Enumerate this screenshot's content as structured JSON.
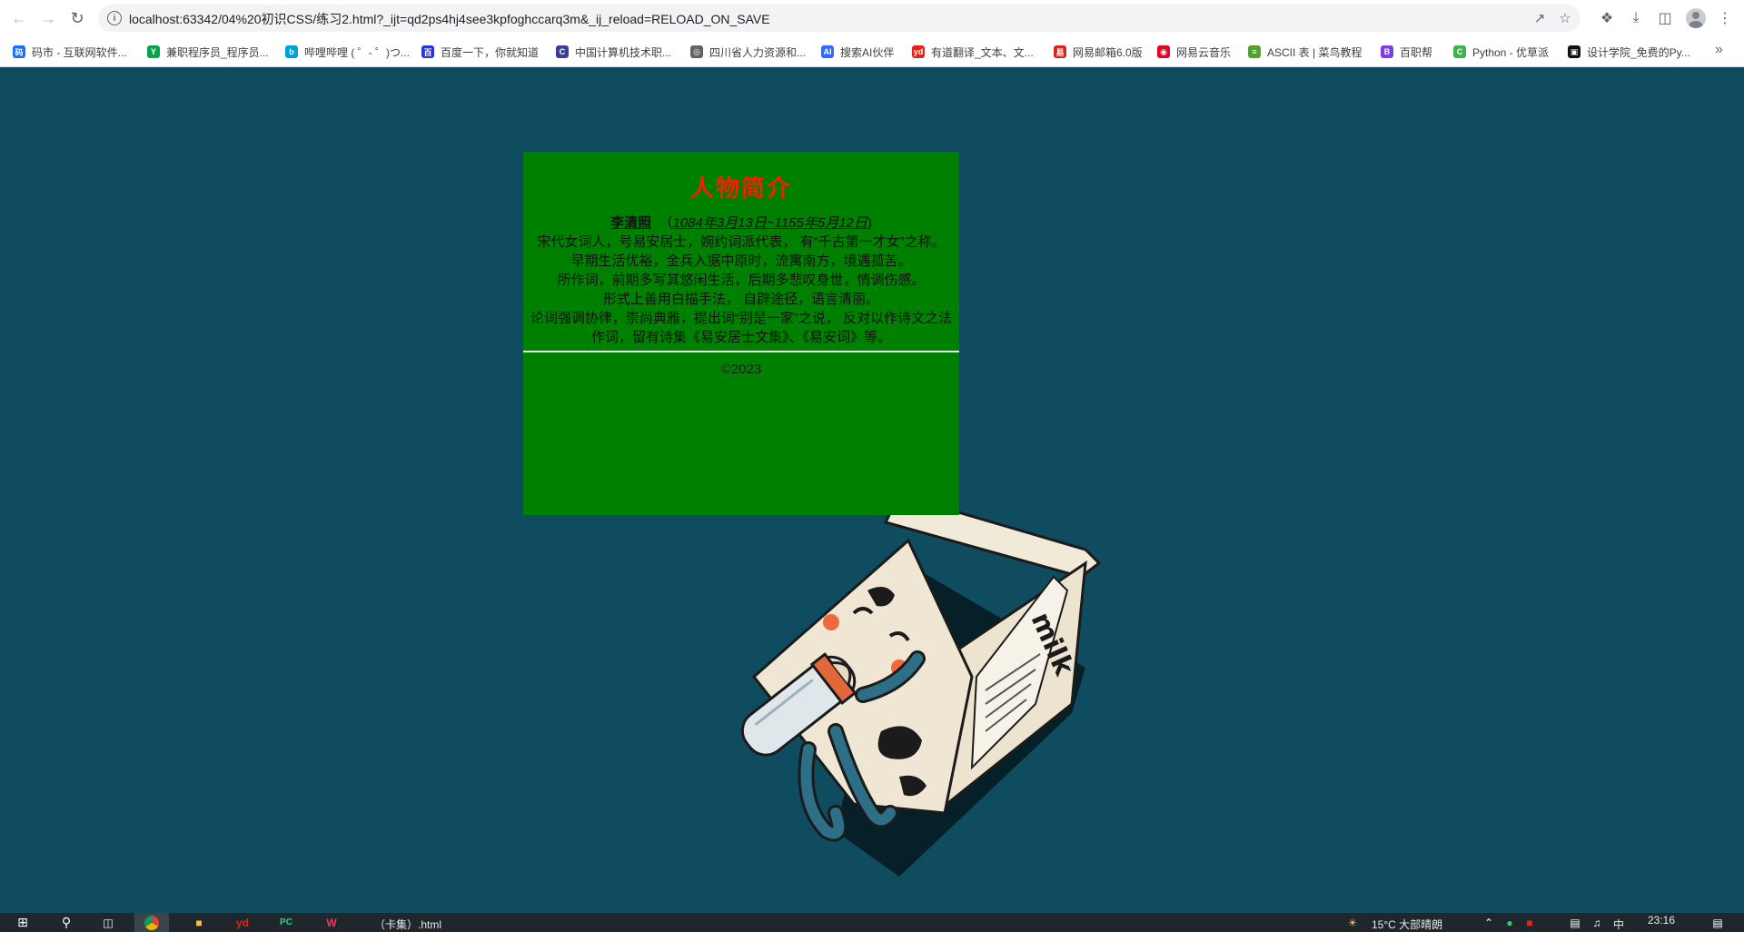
{
  "browser": {
    "url": "localhost:63342/04%20初识CSS/练习2.html?_ijt=qd2ps4hj4see3kpfoghccarq3m&_ij_reload=RELOAD_ON_SAVE",
    "bookmarks": [
      {
        "label": "码市 - 互联网软件...",
        "icon": "mashi-icon",
        "color": "#1d6ff2",
        "glyph": "码"
      },
      {
        "label": "兼职程序员_程序员...",
        "icon": "y-logo-icon",
        "color": "#0aa14b",
        "glyph": "Y"
      },
      {
        "label": "哔哩哔哩 ( ゜- ゜)つ...",
        "icon": "bilibili-icon",
        "color": "#00a1d6",
        "glyph": "b"
      },
      {
        "label": "百度一下，你就知道",
        "icon": "baidu-icon",
        "color": "#2932e1",
        "glyph": "百"
      },
      {
        "label": "中国计算机技术职...",
        "icon": "ccf-icon",
        "color": "#3b3f99",
        "glyph": "C"
      },
      {
        "label": "四川省人力资源和...",
        "icon": "globe-icon",
        "color": "#5f6368",
        "glyph": "◎"
      },
      {
        "label": "搜索AI伙伴",
        "icon": "ai-icon",
        "color": "#2f6bff",
        "glyph": "AI"
      },
      {
        "label": "有道翻译_文本、文...",
        "icon": "youdao-icon",
        "color": "#e1251b",
        "glyph": "yd"
      },
      {
        "label": "网易邮箱6.0版",
        "icon": "netease-mail-icon",
        "color": "#d9261c",
        "glyph": "易"
      },
      {
        "label": "网易云音乐",
        "icon": "netease-music-icon",
        "color": "#e60026",
        "glyph": "◉"
      },
      {
        "label": "ASCII 表 | 菜鸟教程",
        "icon": "runoob-icon",
        "color": "#56a02f",
        "glyph": "≡"
      },
      {
        "label": "百职帮",
        "icon": "baizhibang-icon",
        "color": "#7b3fe4",
        "glyph": "B"
      },
      {
        "label": "Python - 优草派",
        "icon": "youcaopai-icon",
        "color": "#3fb34f",
        "glyph": "C"
      },
      {
        "label": "设计学院_免费的Py...",
        "icon": "sjxy-icon",
        "color": "#111111",
        "glyph": "▣"
      }
    ]
  },
  "card": {
    "title": "人物简介",
    "name": "李清照",
    "dates": "1084年3月13日~1155年5月12日",
    "lines": [
      "宋代女词人，号易安居士，婉约词派代表， 有“千古第一才女”之称。",
      "早期生活优裕，金兵入据中原时，流寓南方，境遇孤苦。",
      "所作词，前期多写其悠闲生活，后期多悲叹身世，情调伤感。",
      "形式上善用白描手法， 自辟途径，语言清丽。",
      "论词强调协律，崇尚典雅，提出词“别是一家”之说， 反对以作诗文之法作词，留有诗集《易安居士文集》、《易安词》等。"
    ],
    "footer": "©2023",
    "title_color": "#ff1a00",
    "background_color": "#008000"
  },
  "page": {
    "background_color": "#0f4c60"
  },
  "illustration": {
    "label": "milk"
  },
  "taskbar": {
    "window_text": "（卡集）.html",
    "weather": "15°C 大部晴朗",
    "ime": "中",
    "time": "23:16"
  }
}
